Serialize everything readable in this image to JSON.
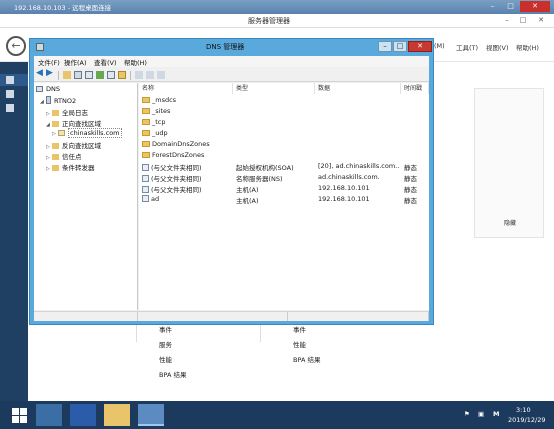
{
  "rdp": {
    "title": "192.168.10.103 - 远程桌面连接",
    "center_title": "服务器管理器"
  },
  "server_manager": {
    "window_title": "服务器管理器",
    "menu": [
      "(M)",
      "工具(T)",
      "视图(V)",
      "帮助(H)"
    ],
    "tile1": [
      "事件",
      "服务",
      "性能",
      "BPA 结果"
    ],
    "tile2": [
      "事件",
      "性能",
      "BPA 结果"
    ],
    "hide_label": "隐藏"
  },
  "dns": {
    "window_title": "DNS 管理器",
    "menus": [
      "文件(F)",
      "操作(A)",
      "查看(V)",
      "帮助(H)"
    ],
    "tree": {
      "root": "DNS",
      "server": "RTNO2",
      "global_logs": "全局日志",
      "forward_zones": "正向查找区域",
      "zone": "chinaskills.com",
      "reverse_zones": "反向查找区域",
      "trust_points": "信任点",
      "conditional_forwarders": "条件转发器"
    },
    "columns": [
      "名称",
      "类型",
      "数据",
      "时间戳"
    ],
    "rows": [
      {
        "name": "_msdcs",
        "type": "",
        "data": "",
        "ts": "",
        "kind": "folder"
      },
      {
        "name": "_sites",
        "type": "",
        "data": "",
        "ts": "",
        "kind": "folder"
      },
      {
        "name": "_tcp",
        "type": "",
        "data": "",
        "ts": "",
        "kind": "folder"
      },
      {
        "name": "_udp",
        "type": "",
        "data": "",
        "ts": "",
        "kind": "folder"
      },
      {
        "name": "DomainDnsZones",
        "type": "",
        "data": "",
        "ts": "",
        "kind": "folder"
      },
      {
        "name": "ForestDnsZones",
        "type": "",
        "data": "",
        "ts": "",
        "kind": "folder"
      },
      {
        "name": "(与父文件夹相同)",
        "type": "起始授权机构(SOA)",
        "data": "[20], ad.chinaskills.com...",
        "ts": "静态",
        "kind": "record"
      },
      {
        "name": "(与父文件夹相同)",
        "type": "名称服务器(NS)",
        "data": "ad.chinaskills.com.",
        "ts": "静态",
        "kind": "record"
      },
      {
        "name": "(与父文件夹相同)",
        "type": "主机(A)",
        "data": "192.168.10.101",
        "ts": "静态",
        "kind": "record"
      },
      {
        "name": "ad",
        "type": "主机(A)",
        "data": "192.168.10.101",
        "ts": "静态",
        "kind": "record"
      }
    ]
  },
  "taskbar": {
    "time": "3:10",
    "date": "2019/12/29",
    "ime": "M"
  }
}
